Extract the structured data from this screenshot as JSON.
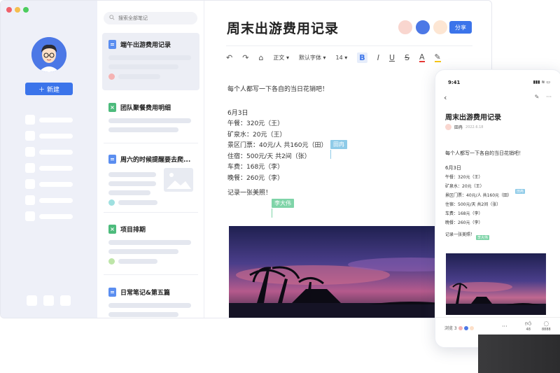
{
  "sidebar": {
    "new_button_label": "新建",
    "colors": {
      "bg": "#eef0f8",
      "accent": "#3b74ea"
    }
  },
  "list": {
    "search_placeholder": "搜索全部笔记",
    "items": [
      {
        "title": "端午出游费用记录",
        "type": "doc",
        "active": true
      },
      {
        "title": "团队聚餐费用明细",
        "type": "sheet"
      },
      {
        "title": "周六的时候提醒要去爬...",
        "type": "doc"
      },
      {
        "title": "项目排期",
        "type": "sheet"
      },
      {
        "title": "日常笔记&第五篇",
        "type": "doc"
      }
    ]
  },
  "editor": {
    "title": "周末出游费用记录",
    "share_label": "分享",
    "toolbar": {
      "style": "正文",
      "font": "默认字体",
      "size": "14"
    },
    "intro": "每个人都写一下各自的当日花销吧！",
    "date": "6月3日",
    "lines": [
      "午餐：320元（王）",
      "矿泉水：20元（王）",
      "景区门票：40元/人  共160元（田）",
      "住宿：500元/天  共2间（张）",
      "车费：168元（李）",
      "晚餐：260元（李）"
    ],
    "photo_line": "记录一张美照！",
    "cursor_tags": [
      "田冉",
      "李大伟"
    ]
  },
  "phone": {
    "time": "9:41",
    "title": "周末出游费用记录",
    "author": "田冉",
    "date": "2022.6.18",
    "intro": "每个人都写一下各自的当日花销吧！",
    "date_heading": "6月3日",
    "lines": [
      "午餐：320元（王）",
      "矿泉水：20元（王）",
      "景区门票：40元/人  共160元（田）",
      "住宿：500元/天  共2间（张）",
      "车费：168元（李）",
      "晚餐：260元（李）"
    ],
    "photo_line": "记录一张美照！",
    "cursor_tags": [
      "田冉",
      "李大伟"
    ],
    "viewers_label": "浏览 3",
    "like_count": "48",
    "comment_label": "8888"
  }
}
